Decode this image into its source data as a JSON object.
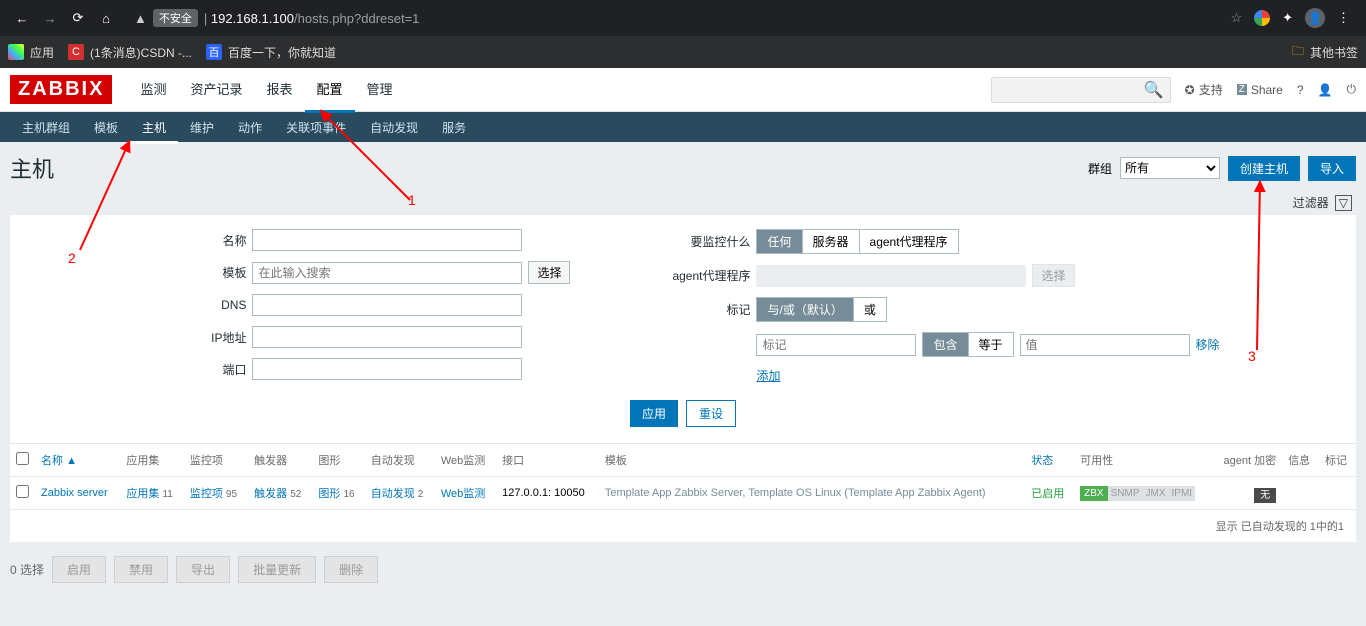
{
  "browser": {
    "url_host": "192.168.1.100",
    "url_path": "/hosts.php?ddreset=1",
    "insecure_chip": "不安全",
    "apps_label": "应用",
    "bookmarks": [
      {
        "icon_bg": "#d32f2f",
        "icon_text": "C",
        "label": "(1条消息)CSDN -..."
      },
      {
        "icon_bg": "#2962ff",
        "icon_text": "百",
        "label": "百度一下，你就知道"
      }
    ],
    "other_bookmarks": "其他书签"
  },
  "header": {
    "logo": "ZABBIX",
    "main_nav": [
      "监测",
      "资产记录",
      "报表",
      "配置",
      "管理"
    ],
    "main_nav_active_index": 3,
    "support": "支持",
    "share": "Share"
  },
  "subnav": {
    "items": [
      "主机群组",
      "模板",
      "主机",
      "维护",
      "动作",
      "关联项事件",
      "自动发现",
      "服务"
    ],
    "active_index": 2
  },
  "title_row": {
    "title": "主机",
    "group_label": "群组",
    "group_value": "所有",
    "create_btn": "创建主机",
    "import_btn": "导入"
  },
  "filter_bar": {
    "label": "过滤器"
  },
  "filter": {
    "left": {
      "name_label": "名称",
      "template_label": "模板",
      "template_placeholder": "在此输入搜索",
      "select_btn": "选择",
      "dns_label": "DNS",
      "ip_label": "IP地址",
      "port_label": "端口"
    },
    "right": {
      "monitor_label": "要监控什么",
      "monitor_opts": [
        "任何",
        "服务器",
        "agent代理程序"
      ],
      "proxy_label": "agent代理程序",
      "proxy_select": "选择",
      "tags_label": "标记",
      "tag_mode_opts": [
        "与/或（默认）",
        "或"
      ],
      "tag_name_placeholder": "标记",
      "tag_op_opts": [
        "包含",
        "等于"
      ],
      "tag_value_placeholder": "值",
      "tag_remove": "移除",
      "tag_add": "添加"
    },
    "apply_btn": "应用",
    "reset_btn": "重设"
  },
  "table": {
    "headers": {
      "name": "名称",
      "apps": "应用集",
      "items": "监控项",
      "triggers": "触发器",
      "graphs": "图形",
      "discovery": "自动发现",
      "web": "Web监测",
      "iface": "接口",
      "templates": "模板",
      "status": "状态",
      "avail": "可用性",
      "agent_enc": "agent 加密",
      "info": "信息",
      "tags": "标记"
    },
    "sort_arrow": "▲",
    "rows": [
      {
        "name": "Zabbix server",
        "apps": {
          "label": "应用集",
          "count": "11"
        },
        "items": {
          "label": "监控项",
          "count": "95"
        },
        "triggers": {
          "label": "触发器",
          "count": "52"
        },
        "graphs": {
          "label": "图形",
          "count": "16"
        },
        "discovery": {
          "label": "自动发现",
          "count": "2"
        },
        "web": {
          "label": "Web监测"
        },
        "iface": "127.0.0.1: 10050",
        "templates_text": "Template App Zabbix Server, Template OS Linux (Template App Zabbix Agent)",
        "status": "已启用",
        "avail": [
          "ZBX",
          "SNMP",
          "JMX",
          "IPMI"
        ],
        "enc": "无"
      }
    ],
    "footer": "显示 已自动发现的 1中的1"
  },
  "bottom": {
    "selected": "0 选择",
    "buttons": [
      "启用",
      "禁用",
      "导出",
      "批量更新",
      "删除"
    ]
  },
  "annotations": {
    "l1": "1",
    "l2": "2",
    "l3": "3"
  }
}
